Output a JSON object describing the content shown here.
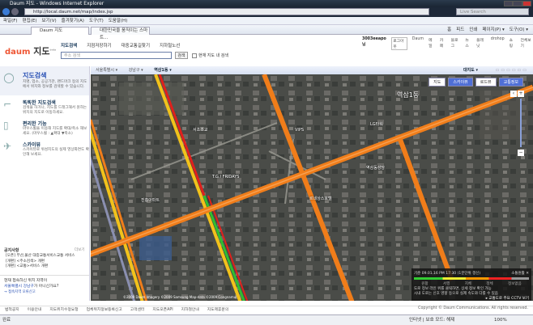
{
  "window": {
    "title": "Daum 지도 - Windows Internet Explorer",
    "url": "http://local.daum.net/map/index.jsp",
    "search_placeholder": "Live Search"
  },
  "menu": [
    "파일(F)",
    "편집(E)",
    "보기(V)",
    "즐겨찾기(A)",
    "도구(T)",
    "도움말(H)"
  ],
  "tabs": [
    {
      "label": "Daum 지도"
    },
    {
      "label": "대한민국을 움직이는 스마트..."
    }
  ],
  "tabtools": [
    "홈",
    "피드",
    "인쇄",
    "페이지(P) ▾",
    "도구(O) ▾"
  ],
  "header": {
    "logo": "daum",
    "logo_suffix": "지도",
    "beta": "beta",
    "nav": [
      "지도검색",
      "지점저장하기",
      "대중교통길찾기",
      "지하철노선"
    ],
    "search_placeholder": "주소 검색",
    "search_button": "검색",
    "checkbox_label": "현재 지도 내 검색",
    "toplinks": [
      "3003eeapo님",
      "로그아웃",
      "Daum",
      "메일",
      "카페",
      "블로그",
      "뉴스",
      "플래닛",
      "drohop",
      "쇼핑",
      "전체보기"
    ]
  },
  "left": {
    "sections": [
      {
        "title": "지도검색",
        "desc": "지명, 업소, 공공기관, 랜드마크 등의 지도에서 위치와 정보를 검색할 수 있습니다."
      },
      {
        "title": "똑똑한 지도검색",
        "desc": "검색을 하거나, 지도를 드래그해서 원하는 위치의 지도로 이동하세요."
      },
      {
        "title": "편리한 기능",
        "desc": "마우스휠을 이용해 지도를 확대/축소 해보세요. (마우스휠 : ▲확대 ▼축소)"
      },
      {
        "title": "스카이뷰",
        "desc": "스카이뷰로 위성지도의 실제 영상화면도 확인해 보세요."
      }
    ],
    "notice_title": "공지사항",
    "notice_more": "더보기",
    "notices": [
      "[오픈] 부산,울산 대중교통서비스교통 서비스",
      "[개편] <주소검색> 개편",
      "[개편] <교통>서비스 개편"
    ],
    "location_q": "현재 접속하신 위치 지역이",
    "location_place": "서울특별시 강남구",
    "location_q2": "가 아니신가요?",
    "location_link": "→ 접속지역 오류신고"
  },
  "map": {
    "breadcrumb": [
      "서울특별시 ▾",
      "강남구 ▾",
      "역삼1동 ▾"
    ],
    "bigmap": "대지도 ▾",
    "types": [
      "지도",
      "스카이뷰",
      "로드뷰",
      "교통정보"
    ],
    "labels": [
      "역삼1동",
      "T.G.I FRIDAYS",
      "VIPS",
      "LG타워",
      "진흥아파트",
      "서초초교",
      "역삼동성당",
      "르네상스호텔"
    ],
    "legend": {
      "time": "기준 09.01.16 PM 17:30 (1분단위 갱신)",
      "toggle": "소통원활",
      "close": "✕",
      "levels": [
        "원활",
        "서행",
        "지체",
        "정체",
        "정보없음"
      ],
      "notes": [
        "도로 정보 라인 위를 클릭하면, 상세 정보 확인 가능",
        "시내 도로는 신호 영향 등으로 실제 속도와 다를 수 있음"
      ],
      "cctv": "▸ 교통도로 주요 CCTV 보기"
    },
    "copyright_map": "©2009 Daum  Imagery ©2009 Samsung Map-data ©2009 Congnamul"
  },
  "footer": {
    "links": [
      "법적공지",
      "이용안내",
      "지도위치수정요청",
      "업체위치정보등록신고",
      "고객센터",
      "지도오픈API",
      "지하철안내",
      "지도제휴문의"
    ],
    "copyright": "Copyright © Daum Communications. All rights reserved."
  },
  "status": {
    "left": "완료",
    "zone": "인터넷 | 보호 모드: 해제",
    "zoom": "100%"
  },
  "colors": {
    "road_orange": "#f07d1a",
    "road_yellow": "#f2c21b",
    "road_red": "#e0201b",
    "road_green": "#2fbf2f",
    "accent": "#4f6fd6"
  }
}
